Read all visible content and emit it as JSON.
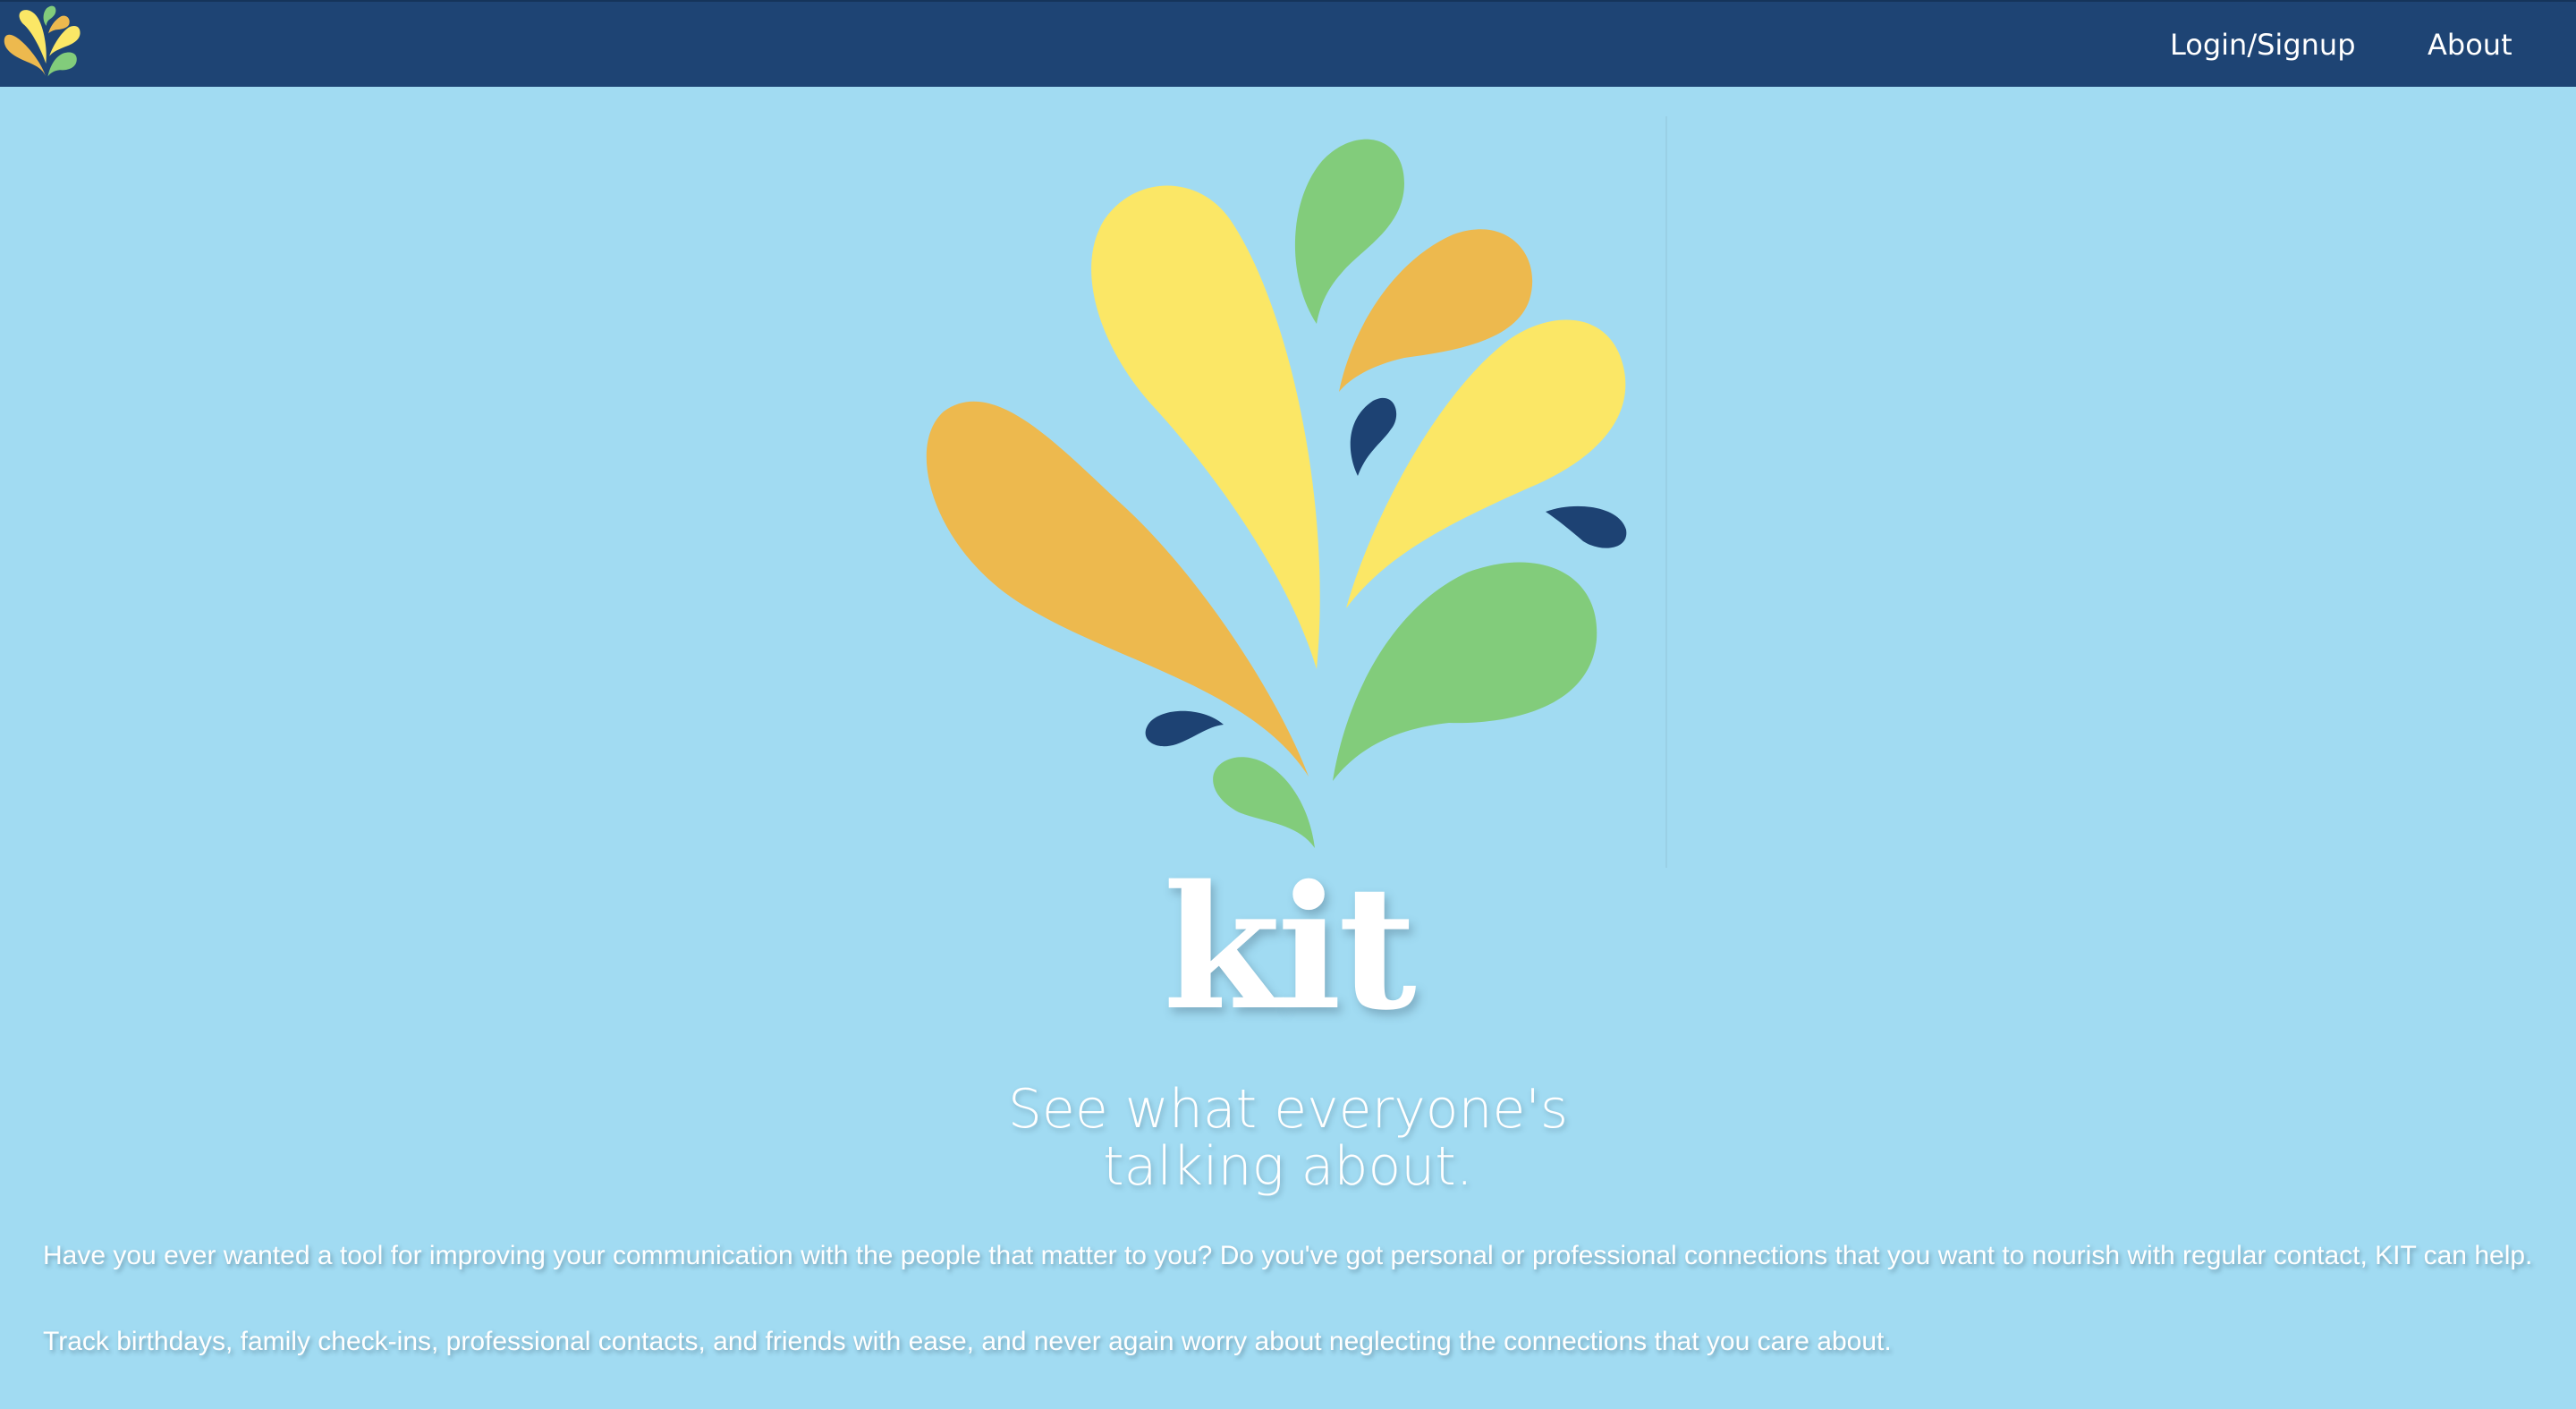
{
  "colors": {
    "page_background": "#a1dbf2",
    "navbar": "#1e4474",
    "text": "#ffffff",
    "petal_yellow": "#fbe766",
    "petal_orange": "#edb94e",
    "petal_green": "#82cc7b",
    "petal_navy": "#1d4273"
  },
  "nav": {
    "logo_icon": "kit-flower-logo-icon",
    "links": [
      {
        "label": "Login/Signup"
      },
      {
        "label": "About"
      }
    ]
  },
  "hero": {
    "logo_icon": "kit-flower-logo-icon",
    "brand": "kit",
    "tagline_line1": "See what everyone's",
    "tagline_line2": "talking about."
  },
  "intro": {
    "paragraph1": "Have you ever wanted a tool for improving your communication with the people that matter to you? Do you've got personal or professional connections that you want to nourish with regular contact, KIT can help.",
    "paragraph2": "Track birthdays, family check-ins, professional contacts, and friends with ease, and never again worry about neglecting the connections that you care about."
  }
}
